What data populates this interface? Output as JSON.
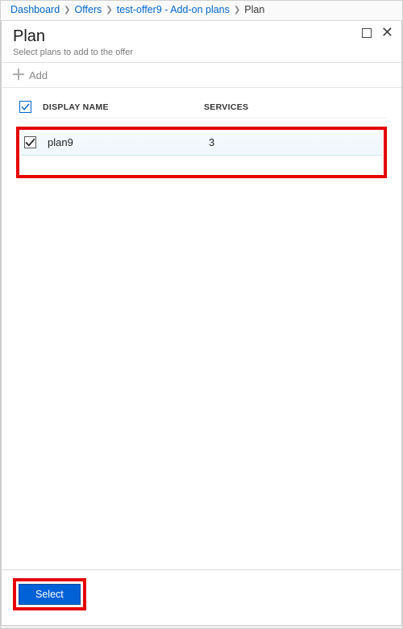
{
  "breadcrumb": {
    "items": [
      {
        "label": "Dashboard"
      },
      {
        "label": "Offers"
      },
      {
        "label": "test-offer9 - Add-on plans"
      }
    ],
    "current": "Plan"
  },
  "header": {
    "title": "Plan",
    "subtitle": "Select plans to add to the offer"
  },
  "toolbar": {
    "add_label": "Add"
  },
  "table": {
    "head_display": "DISPLAY NAME",
    "head_services": "SERVICES",
    "rows": [
      {
        "display_name": "plan9",
        "services": "3"
      }
    ]
  },
  "footer": {
    "select_label": "Select"
  }
}
